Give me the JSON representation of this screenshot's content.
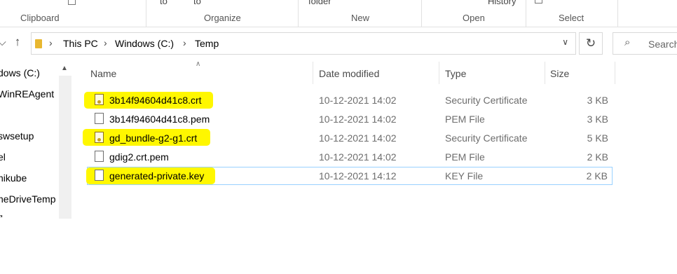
{
  "ribbon": {
    "groups": [
      "Clipboard",
      "Organize",
      "New",
      "Open",
      "Select"
    ],
    "fragments": {
      "to_1": "to",
      "to_2": "to",
      "folder": "folder",
      "history": "History"
    }
  },
  "address": {
    "crumbs": [
      "This PC",
      "Windows (C:)",
      "Temp"
    ],
    "search_placeholder": "Search"
  },
  "nav_pane": {
    "items": [
      "dows (C:)",
      "WinREAgent",
      "swsetup",
      "el",
      "nikube",
      "neDriveTemp",
      "fl"
    ]
  },
  "columns": {
    "name": "Name",
    "date": "Date modified",
    "type": "Type",
    "size": "Size"
  },
  "files": [
    {
      "name": "3b14f94604d41c8.crt",
      "date": "10-12-2021 14:02",
      "type": "Security Certificate",
      "size": "3 KB",
      "icon": "certificate-icon",
      "highlighted": true
    },
    {
      "name": "3b14f94604d41c8.pem",
      "date": "10-12-2021 14:02",
      "type": "PEM File",
      "size": "3 KB",
      "icon": "file-icon",
      "highlighted": false
    },
    {
      "name": "gd_bundle-g2-g1.crt",
      "date": "10-12-2021 14:02",
      "type": "Security Certificate",
      "size": "5 KB",
      "icon": "certificate-icon",
      "highlighted": true
    },
    {
      "name": "gdig2.crt.pem",
      "date": "10-12-2021 14:02",
      "type": "PEM File",
      "size": "2 KB",
      "icon": "file-icon",
      "highlighted": false
    },
    {
      "name": "generated-private.key",
      "date": "10-12-2021 14:12",
      "type": "KEY File",
      "size": "2 KB",
      "icon": "file-icon",
      "highlighted": true,
      "selected": true
    }
  ],
  "colors": {
    "highlight": "#fff700",
    "selection_border": "#99d1ff",
    "folder": "#e8b730"
  }
}
